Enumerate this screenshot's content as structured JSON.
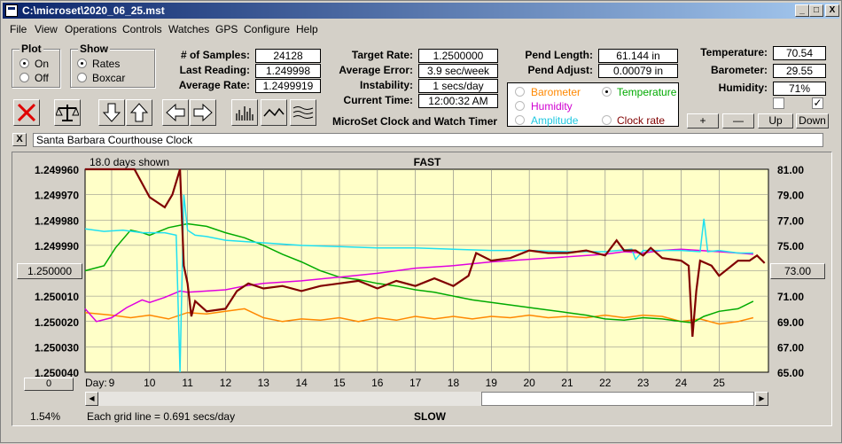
{
  "window": {
    "title": "C:\\microset\\2020_06_25.mst",
    "minimize": "_",
    "maximize": "□",
    "close": "X"
  },
  "menu": [
    "File",
    "View",
    "Operations",
    "Controls",
    "Watches",
    "GPS",
    "Configure",
    "Help"
  ],
  "plot_group": {
    "title": "Plot",
    "on_label": "On",
    "off_label": "Off",
    "selected": "On"
  },
  "show_group": {
    "title": "Show",
    "rates_label": "Rates",
    "boxcar_label": "Boxcar",
    "selected": "Rates"
  },
  "stats": {
    "samples_label": "# of Samples:",
    "samples_value": "24128",
    "last_label": "Last Reading:",
    "last_value": "1.249998",
    "avg_rate_label": "Average Rate:",
    "avg_rate_value": "1.2499919"
  },
  "rates": {
    "target_label": "Target Rate:",
    "target_value": "1.2500000",
    "avg_error_label": "Average Error:",
    "avg_error_value": "3.9 sec/week",
    "instability_label": "Instability:",
    "instability_value": "1 secs/day",
    "current_time_label": "Current Time:",
    "current_time_value": "12:00:32 AM"
  },
  "pendulum": {
    "length_label": "Pend Length:",
    "length_value": "61.144 in",
    "adjust_label": "Pend Adjust:",
    "adjust_value": "0.00079 in"
  },
  "sensor_radios": {
    "barometer": "Barometer",
    "temperature": "Temperature",
    "humidity": "Humidity",
    "amplitude": "Amplitude",
    "clock_rate": "Clock rate",
    "selected": "Temperature"
  },
  "environment": {
    "temp_label": "Temperature:",
    "temp_value": "70.54",
    "baro_label": "Barometer:",
    "baro_value": "29.55",
    "humid_label": "Humidity:",
    "humid_value": "71%"
  },
  "scale_buttons": {
    "plus": "+",
    "minus": "—",
    "up": "Up",
    "down": "Down"
  },
  "app_caption": "MicroSet Clock and Watch Timer",
  "clock_name": "Santa Barbara Courthouse Clock",
  "clear_button": "X",
  "chart_footer": {
    "scale_pct": "1.54%",
    "offset_button": "0",
    "grid_note": "Each grid line = 0.691 secs/day",
    "left_center_button": "1.250000",
    "right_center_button": "73.00"
  },
  "colors": {
    "rate": "#800000",
    "temperature": "#00aa00",
    "humidity": "#e000e0",
    "amplitude": "#20e0f0",
    "barometer": "#ff8800",
    "plot_bg": "#ffffc8"
  },
  "chart_data": {
    "type": "line",
    "title": "FAST",
    "bottom_label": "SLOW",
    "days_shown": "18.0 days shown",
    "xlabel": "Day:",
    "x_range": [
      8.3,
      26.3
    ],
    "x_ticks": [
      9,
      10,
      11,
      12,
      13,
      14,
      15,
      16,
      17,
      18,
      19,
      20,
      21,
      22,
      23,
      24,
      25
    ],
    "y_left_range": [
      1.24996,
      1.25004
    ],
    "y_left_ticks": [
      "1.249960",
      "1.249970",
      "1.249980",
      "1.249990",
      "1.250000",
      "1.250010",
      "1.250020",
      "1.250030",
      "1.250040"
    ],
    "y_left_inverted": true,
    "y_right_range": [
      65,
      81
    ],
    "y_right_ticks": [
      "81.00",
      "79.00",
      "77.00",
      "75.00",
      "73.00",
      "71.00",
      "69.00",
      "67.00",
      "65.00"
    ],
    "grid": true,
    "series": [
      {
        "key": "rate",
        "axis": "left",
        "x": [
          8.3,
          9.0,
          9.6,
          10.0,
          10.4,
          10.6,
          10.8,
          10.9,
          11.0,
          11.1,
          11.2,
          11.5,
          12.0,
          12.3,
          12.6,
          13.0,
          13.5,
          14.0,
          14.5,
          15.0,
          15.5,
          16.0,
          16.5,
          17.0,
          17.5,
          18.0,
          18.4,
          18.6,
          19.0,
          19.5,
          20.0,
          20.5,
          21.0,
          21.5,
          22.0,
          22.3,
          22.5,
          22.8,
          23.0,
          23.2,
          23.5,
          24.0,
          24.2,
          24.3,
          24.4,
          24.5,
          24.8,
          25.0,
          25.5,
          25.8,
          26.0,
          26.2
        ],
        "y": [
          1.24996,
          1.24996,
          1.24996,
          1.249971,
          1.249975,
          1.24997,
          1.24996,
          1.249998,
          1.250005,
          1.250018,
          1.250012,
          1.250016,
          1.250015,
          1.250008,
          1.250005,
          1.250007,
          1.250006,
          1.250008,
          1.250006,
          1.250005,
          1.250004,
          1.250007,
          1.250004,
          1.250006,
          1.250003,
          1.250006,
          1.250002,
          1.249993,
          1.249996,
          1.249995,
          1.249992,
          1.249993,
          1.249993,
          1.249992,
          1.249994,
          1.249988,
          1.249992,
          1.249992,
          1.249994,
          1.249991,
          1.249995,
          1.249996,
          1.249998,
          1.250026,
          1.250008,
          1.249996,
          1.249998,
          1.250002,
          1.249996,
          1.249996,
          1.249994,
          1.249997
        ]
      },
      {
        "key": "temperature",
        "axis": "right",
        "x": [
          8.3,
          8.8,
          9.1,
          9.5,
          9.8,
          10.0,
          10.5,
          11.0,
          11.5,
          12.0,
          12.5,
          13.0,
          13.5,
          14.0,
          14.5,
          15.0,
          15.5,
          16.0,
          16.5,
          17.0,
          17.5,
          18.0,
          18.5,
          19.0,
          19.5,
          20.0,
          20.5,
          21.0,
          21.5,
          22.0,
          22.5,
          23.0,
          23.5,
          24.0,
          24.3,
          24.6,
          25.0,
          25.5,
          25.9
        ],
        "y": [
          73.0,
          73.4,
          74.8,
          76.2,
          76.0,
          75.8,
          76.4,
          76.7,
          76.5,
          76.0,
          75.6,
          75.0,
          74.3,
          73.7,
          73.0,
          72.5,
          72.3,
          72.0,
          71.8,
          71.5,
          71.3,
          71.0,
          70.7,
          70.5,
          70.3,
          70.1,
          69.9,
          69.7,
          69.5,
          69.2,
          69.1,
          69.3,
          69.2,
          69.0,
          68.9,
          69.4,
          69.8,
          70.0,
          70.6
        ]
      },
      {
        "key": "humidity",
        "axis": "right",
        "x": [
          8.3,
          8.6,
          9.0,
          9.4,
          9.8,
          10.0,
          10.4,
          10.8,
          11.0,
          11.5,
          12.0,
          12.5,
          13.0,
          14.0,
          15.0,
          16.0,
          17.0,
          18.0,
          19.0,
          20.0,
          21.0,
          22.0,
          22.5,
          23.0,
          23.5,
          24.0,
          24.5,
          25.0,
          25.5,
          25.9
        ],
        "y": [
          70.0,
          69.0,
          69.3,
          70.1,
          70.7,
          70.5,
          70.9,
          71.4,
          71.3,
          71.4,
          71.5,
          71.8,
          72.0,
          72.2,
          72.5,
          72.8,
          73.2,
          73.4,
          73.7,
          73.9,
          74.1,
          74.3,
          74.5,
          74.4,
          74.6,
          74.7,
          74.6,
          74.5,
          74.4,
          74.3
        ]
      },
      {
        "key": "amplitude",
        "axis": "right",
        "x": [
          8.3,
          8.8,
          9.3,
          9.8,
          10.4,
          10.7,
          10.8,
          10.9,
          11.0,
          11.2,
          11.5,
          12.0,
          13.0,
          14.0,
          15.0,
          16.0,
          17.0,
          18.0,
          19.0,
          20.0,
          21.0,
          22.0,
          22.7,
          22.8,
          23.0,
          24.0,
          24.5,
          24.6,
          24.7,
          25.0,
          25.5,
          25.9
        ],
        "y": [
          76.3,
          76.1,
          76.2,
          76.0,
          76.0,
          75.8,
          65.0,
          79.0,
          76.2,
          75.8,
          75.7,
          75.4,
          75.2,
          75.0,
          74.9,
          74.8,
          74.8,
          74.7,
          74.6,
          74.6,
          74.5,
          74.5,
          74.7,
          73.9,
          74.6,
          74.6,
          74.5,
          77.1,
          74.5,
          74.6,
          74.4,
          74.4
        ]
      },
      {
        "key": "barometer",
        "axis": "right",
        "x": [
          8.3,
          9.0,
          9.5,
          10.0,
          10.5,
          11.0,
          11.5,
          12.0,
          12.5,
          13.0,
          13.5,
          14.0,
          14.5,
          15.0,
          15.5,
          16.0,
          16.5,
          17.0,
          17.5,
          18.0,
          18.5,
          19.0,
          19.5,
          20.0,
          20.5,
          21.0,
          21.5,
          22.0,
          22.5,
          23.0,
          23.5,
          24.0,
          24.5,
          25.0,
          25.5,
          25.9
        ],
        "y": [
          69.7,
          69.5,
          69.3,
          69.5,
          69.2,
          69.7,
          69.6,
          69.8,
          70.0,
          69.3,
          69.0,
          69.2,
          69.1,
          69.3,
          69.0,
          69.3,
          69.1,
          69.4,
          69.2,
          69.4,
          69.2,
          69.4,
          69.3,
          69.5,
          69.3,
          69.4,
          69.3,
          69.5,
          69.3,
          69.5,
          69.4,
          69.0,
          69.2,
          68.8,
          69.0,
          69.3
        ]
      }
    ]
  }
}
